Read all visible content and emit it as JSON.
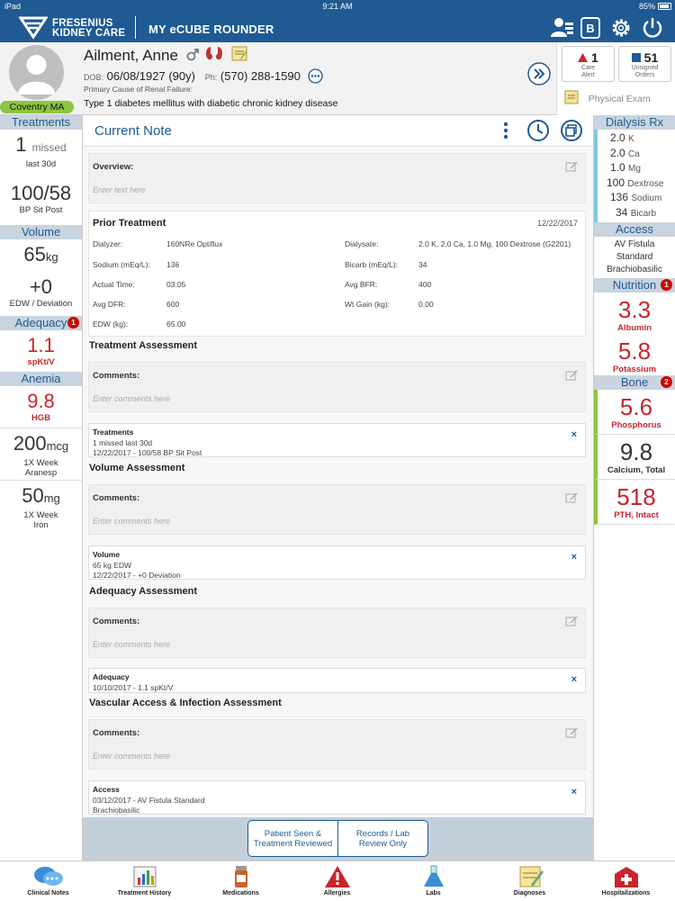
{
  "status": {
    "device": "iPad",
    "time": "9:21 AM",
    "battery": "85%"
  },
  "brand": {
    "line1": "FRESENIUS",
    "line2": "KIDNEY CARE",
    "app": "MY eCUBE ROUNDER"
  },
  "patient": {
    "name": "Ailment, Anne",
    "dob_label": "DOB:",
    "dob": "06/08/1927 (90y)",
    "ph_label": "Ph:",
    "phone": "(570) 288-1590",
    "cause_label": "Primary Cause of Renal Failure:",
    "cause": "Type 1 diabetes mellitus with diabetic chronic kidney disease",
    "site": "Coventry MA"
  },
  "alerts": {
    "care_count": "1",
    "care_label1": "Care",
    "care_label2": "Alert",
    "orders_count": "51",
    "orders_label1": "Unsigned",
    "orders_label2": "Orders",
    "physical_exam": "Physical  Exam"
  },
  "left": {
    "treatments_head": "Treatments",
    "missed_num": "1",
    "missed_label": "missed",
    "missed_period": "last 30d",
    "bp": "100/58",
    "bp_label": "BP Sit Post",
    "volume_head": "Volume",
    "weight": "65",
    "weight_unit": "kg",
    "deviation": "+0",
    "deviation_label": "EDW / Deviation",
    "adequacy_head": "Adequacy",
    "adequacy_badge": "1",
    "adequacy_val": "1.1",
    "adequacy_label": "spKt/V",
    "anemia_head": "Anemia",
    "hgb": "9.8",
    "hgb_label": "HGB",
    "aranesp": "200",
    "aranesp_unit": "mcg",
    "aranesp_freq": "1X Week",
    "aranesp_label": "Aranesp",
    "iron": "50",
    "iron_unit": "mg",
    "iron_freq": "1X Week",
    "iron_label": "Iron"
  },
  "right": {
    "rx_head": "Dialysis Rx",
    "rx": [
      {
        "v": "2.0",
        "u": "K"
      },
      {
        "v": "2.0",
        "u": "Ca"
      },
      {
        "v": "1.0",
        "u": "Mg"
      },
      {
        "v": "100",
        "u": "Dextrose"
      },
      {
        "v": "136",
        "u": "Sodium"
      },
      {
        "v": "34",
        "u": "Bicarb"
      }
    ],
    "access_head": "Access",
    "access1": "AV Fistula",
    "access2": "Standard",
    "access3": "Brachiobasilic",
    "nutrition_head": "Nutrition",
    "nutrition_badge": "1",
    "albumin": "3.3",
    "albumin_label": "Albumin",
    "potassium": "5.8",
    "potassium_label": "Potassium",
    "bone_head": "Bone",
    "bone_badge": "2",
    "phosphorus": "5.6",
    "phosphorus_label": "Phosphorus",
    "calcium": "9.8",
    "calcium_label": "Calcium, Total",
    "pth": "518",
    "pth_label": "PTH, Intact"
  },
  "note": {
    "title": "Current Note",
    "overview_label": "Overview:",
    "overview_placeholder": "Enter text here",
    "prior": {
      "title": "Prior Treatment",
      "date": "12/22/2017",
      "dialyzer_label": "Dialyzer:",
      "dialyzer": "160NRe Optiflux",
      "dialysate_label": "Dialysate:",
      "dialysate": "2.0 K, 2.0 Ca, 1.0 Mg, 100 Dextrose (G2201)",
      "sodium_label": "Sodium (mEq/L):",
      "sodium": "136",
      "bicarb_label": "Bicarb (mEq/L):",
      "bicarb": "34",
      "time_label": "Actual Time:",
      "time": "03:05",
      "bfr_label": "Avg BFR:",
      "bfr": "400",
      "dfr_label": "Avg DFR:",
      "dfr": "600",
      "wtgain_label": "Wt Gain (kg):",
      "wtgain": "0.00",
      "edw_label": "EDW (kg):",
      "edw": "65.00"
    },
    "comments_label": "Comments:",
    "comments_placeholder": "Enter comments here",
    "treatment_assessment": "Treatment Assessment",
    "treatment_info": {
      "title": "Treatments",
      "l1": "1 missed last 30d",
      "l2": "12/22/2017 - 100/58 BP Sit Post"
    },
    "volume_assessment": "Volume Assessment",
    "volume_info": {
      "title": "Volume",
      "l1": "65 kg EDW",
      "l2": "12/22/2017 - +0 Deviation"
    },
    "adequacy_assessment": "Adequacy Assessment",
    "adequacy_info": {
      "title": "Adequacy",
      "l1": "10/10/2017 - 1.1 spKt/V"
    },
    "vascular_assessment": "Vascular Access & Infection Assessment",
    "access_info": {
      "title": "Access",
      "l1": "03/12/2017 - AV Fistula Standard",
      "l2": "Brachiobasilic"
    },
    "remove": "×"
  },
  "actions": {
    "seen1": "Patient Seen &",
    "seen2": "Treatment Reviewed",
    "records1": "Records / Lab",
    "records2": "Review Only"
  },
  "tabs": [
    "Clinical Notes",
    "Treatment History",
    "Medications",
    "Allergies",
    "Labs",
    "Diagnoses",
    "Hospitalizations"
  ],
  "colors": {
    "brand": "#1f5a93",
    "alert_red": "#c8252c",
    "green": "#8cc63f",
    "rx_blue": "#7ec8e3"
  }
}
